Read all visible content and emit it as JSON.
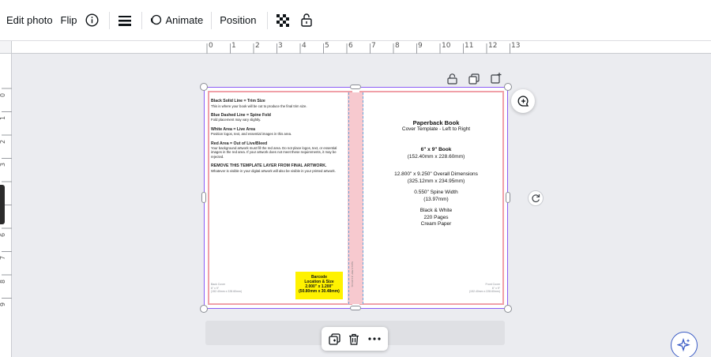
{
  "toolbar": {
    "edit_photo": "Edit photo",
    "flip": "Flip",
    "animate": "Animate",
    "position": "Position"
  },
  "ruler": {
    "top_labels": [
      "0",
      "1",
      "2",
      "3",
      "4",
      "5",
      "6",
      "7",
      "8",
      "9",
      "10",
      "11",
      "12",
      "13"
    ],
    "left_labels": [
      "0",
      "1",
      "2",
      "3",
      "4",
      "5",
      "6",
      "7",
      "8",
      "9"
    ]
  },
  "back_cover": {
    "items": [
      {
        "heading": "Black Solid Line = Trim Size",
        "body": "This is where your book will be cut to produce the final trim size."
      },
      {
        "heading": "Blue Dashed Line = Spine Fold",
        "body": "Fold placement may vary slightly."
      },
      {
        "heading": "White Area = Live Area",
        "body": "Position logos, text, and essential images in this area."
      },
      {
        "heading": "Red Area = Out of Live/Bleed",
        "body": "Your background artwork must fill the red area. Do not place logos, text, or essential images in the red area. If your artwork does not meet these requirements, it may be rejected."
      },
      {
        "heading": "REMOVE THIS TEMPLATE LAYER FROM FINAL ARTWORK.",
        "body": "Whatever is visible in your digital artwork will also be visible in your printed artwork."
      }
    ],
    "barcode": [
      "Barcode",
      "Location & Size",
      "2.000\" x 1.200\"",
      "(50.80mm x 30.48mm)"
    ],
    "note": [
      "Back Cover",
      "6\" x 9\"",
      "(152.40mm x 228.60mm)"
    ]
  },
  "spine_note": "Spine 0.550\" (13.97mm)",
  "front_cover": {
    "title": "Paperback Book",
    "subtitle": "Cover Template - Left to Right",
    "size": "6\" x 9\" Book",
    "size_mm": "(152.40mm x 228.60mm)",
    "overall": "12.800\" x 9.250\" Overall Dimensions",
    "overall_mm": "(325.12mm x 234.95mm)",
    "spine": "0.550\" Spine Width",
    "spine_mm": "(13.97mm)",
    "color": "Black & White",
    "pages": "220 Pages",
    "paper": "Cream Paper",
    "note": [
      "Front Cover",
      "6\" x 9\"",
      "(152.40mm x 228.60mm)"
    ]
  },
  "colors": {
    "selection": "#8b5cf6",
    "bleed": "#f0a0a8",
    "barcode": "#fff200",
    "magic": "#3b5cc6"
  }
}
